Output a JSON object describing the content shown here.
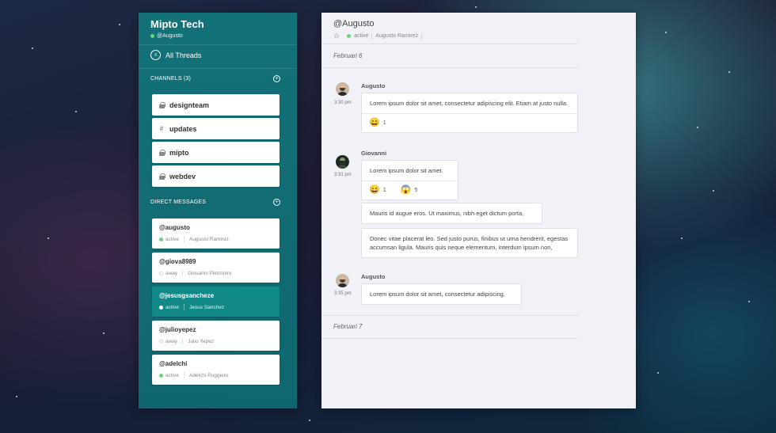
{
  "sidebar": {
    "team_name": "Mipto Tech",
    "current_user": "@Augusto",
    "all_threads": "All Threads",
    "channels_header": "CHANNELS (3)",
    "channels": [
      {
        "name": "designteam",
        "icon": "lock-icon"
      },
      {
        "name": "updates",
        "icon": "hash-icon"
      },
      {
        "name": "mipto",
        "icon": "lock-icon"
      },
      {
        "name": "webdev",
        "icon": "lock-icon"
      }
    ],
    "dm_header": "DIRECT MESSAGES",
    "dms": [
      {
        "handle": "@augusto",
        "status": "active",
        "name": "Augusto Ramirez"
      },
      {
        "handle": "@giova8989",
        "status": "away",
        "name": "Giovanni Pietroniro"
      },
      {
        "handle": "@jesusgsancheze",
        "status": "active",
        "name": "Jesus Sanchez"
      },
      {
        "handle": "@julioyepez",
        "status": "away",
        "name": "Julio Yepez"
      },
      {
        "handle": "@adelchi",
        "status": "active",
        "name": "Adelchi Ruggiero"
      }
    ]
  },
  "chat": {
    "title": "@Augusto",
    "status": "active",
    "full_name": "Augusto Ramirez",
    "date1": "Februari 6",
    "date2": "Februari 7",
    "messages": [
      {
        "author": "Augusto",
        "time": "3:30 pm",
        "text": "Lorem ipsum dolor sit amet, consectetur adipiscing elit. Etiam at justo nulla.",
        "reactions": [
          {
            "emoji": "😄",
            "count": "1"
          }
        ]
      },
      {
        "author": "Giovanni",
        "time": "3:31 pm",
        "text": "Lorem ipsum dolor sit amet.",
        "reactions": [
          {
            "emoji": "😄",
            "count": "1"
          },
          {
            "emoji": "😱",
            "count": "5"
          }
        ],
        "followups": [
          "Mauris id augue eros. Ut maximus, nibh eget dictum porta,",
          "Donec vitae placerat leo. Sed justo purus, finibus ut urna hendrerit, egestas accumsan ligula. Mauris quis neque elementum, interdum ipsum non,"
        ]
      },
      {
        "author": "Augusto",
        "time": "3:35 pm",
        "text": "Lorem ipsum dolor sit amet, consectetur adipiscing."
      }
    ]
  }
}
